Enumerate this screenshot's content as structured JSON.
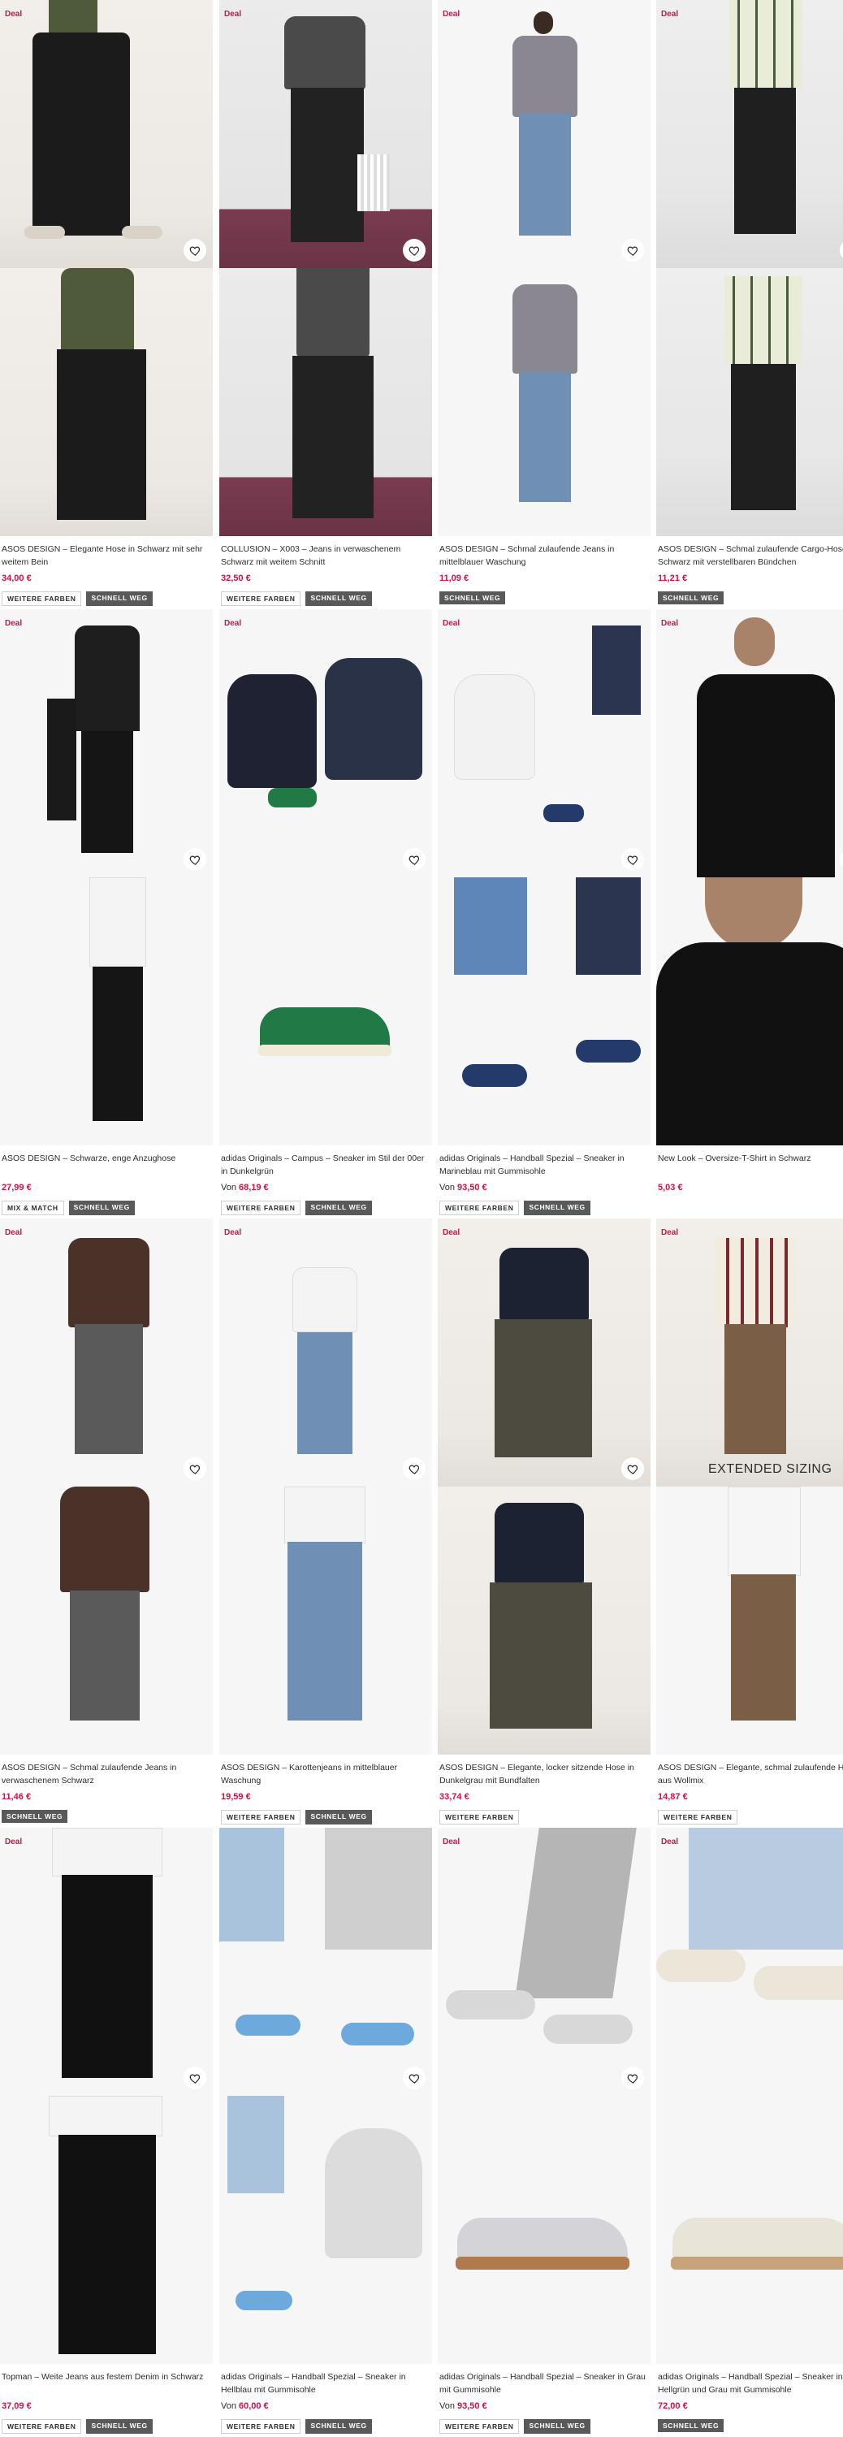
{
  "labels": {
    "deal": "Deal",
    "extended_sizing": "EXTENDED SIZING",
    "from_prefix": "Von"
  },
  "colors": {
    "price": "#d01345",
    "badge_dark": "#595959"
  },
  "products": [
    {
      "title": "ASOS DESIGN – Elegante Hose in Schwarz mit sehr weitem Bein",
      "price": "34,00 €",
      "from": false,
      "deal": true,
      "badges": [
        "WEITERE FARBEN",
        "SCHNELL WEG"
      ]
    },
    {
      "title": "COLLUSION – X003 – Jeans in verwaschenem Schwarz mit weitem Schnitt",
      "price": "32,50 €",
      "from": false,
      "deal": true,
      "badges": [
        "WEITERE FARBEN",
        "SCHNELL WEG"
      ]
    },
    {
      "title": "ASOS DESIGN – Schmal zulaufende Jeans in mittelblauer Waschung",
      "price": "11,09 €",
      "from": false,
      "deal": true,
      "badges": [
        "SCHNELL WEG"
      ]
    },
    {
      "title": "ASOS DESIGN – Schmal zulaufende Cargo-Hose in Schwarz mit verstellbaren Bündchen",
      "price": "11,21 €",
      "from": false,
      "deal": true,
      "badges": [
        "SCHNELL WEG"
      ]
    },
    {
      "title": "ASOS DESIGN – Schwarze, enge Anzughose",
      "price": "27,99 €",
      "from": false,
      "deal": true,
      "badges": [
        "MIX & MATCH",
        "SCHNELL WEG"
      ]
    },
    {
      "title": "adidas Originals – Campus – Sneaker im Stil der 00er in Dunkelgrün",
      "price": "68,19 €",
      "from": true,
      "deal": true,
      "badges": [
        "WEITERE FARBEN",
        "SCHNELL WEG"
      ]
    },
    {
      "title": "adidas Originals – Handball Spezial – Sneaker in Marineblau mit Gummisohle",
      "price": "93,50 €",
      "from": true,
      "deal": true,
      "badges": [
        "WEITERE FARBEN",
        "SCHNELL WEG"
      ]
    },
    {
      "title": "New Look – Oversize-T-Shirt in Schwarz",
      "price": "5,03 €",
      "from": false,
      "deal": true,
      "badges": []
    },
    {
      "title": "ASOS DESIGN – Schmal zulaufende Jeans in verwaschenem Schwarz",
      "price": "11,46 €",
      "from": false,
      "deal": true,
      "badges": [
        "SCHNELL WEG"
      ]
    },
    {
      "title": "ASOS DESIGN – Karottenjeans in mittelblauer Waschung",
      "price": "19,59 €",
      "from": false,
      "deal": true,
      "badges": [
        "WEITERE FARBEN",
        "SCHNELL WEG"
      ]
    },
    {
      "title": "ASOS DESIGN – Elegante, locker sitzende Hose in Dunkelgrau mit Bundfalten",
      "price": "33,74 €",
      "from": false,
      "deal": true,
      "badges": [
        "WEITERE FARBEN"
      ]
    },
    {
      "title": "ASOS DESIGN – Elegante, schmal zulaufende Hose aus Wollmix",
      "price": "14,87 €",
      "from": false,
      "deal": true,
      "badges": [
        "WEITERE FARBEN"
      ]
    },
    {
      "title": "Topman – Weite Jeans aus festem Denim in Schwarz",
      "price": "37,09 €",
      "from": false,
      "deal": true,
      "badges": [
        "WEITERE FARBEN",
        "SCHNELL WEG"
      ]
    },
    {
      "title": "adidas Originals – Handball Spezial – Sneaker in Hellblau mit Gummisohle",
      "price": "60,00 €",
      "from": true,
      "deal": true,
      "badges": [
        "WEITERE FARBEN",
        "SCHNELL WEG"
      ]
    },
    {
      "title": "adidas Originals – Handball Spezial – Sneaker in Grau mit Gummisohle",
      "price": "93,50 €",
      "from": true,
      "deal": true,
      "badges": [
        "WEITERE FARBEN",
        "SCHNELL WEG"
      ]
    },
    {
      "title": "adidas Originals – Handball Spezial – Sneaker in Hellgrün und Grau mit Gummisohle",
      "price": "72,00 €",
      "from": false,
      "deal": true,
      "badges": [
        "SCHNELL WEG"
      ]
    }
  ]
}
